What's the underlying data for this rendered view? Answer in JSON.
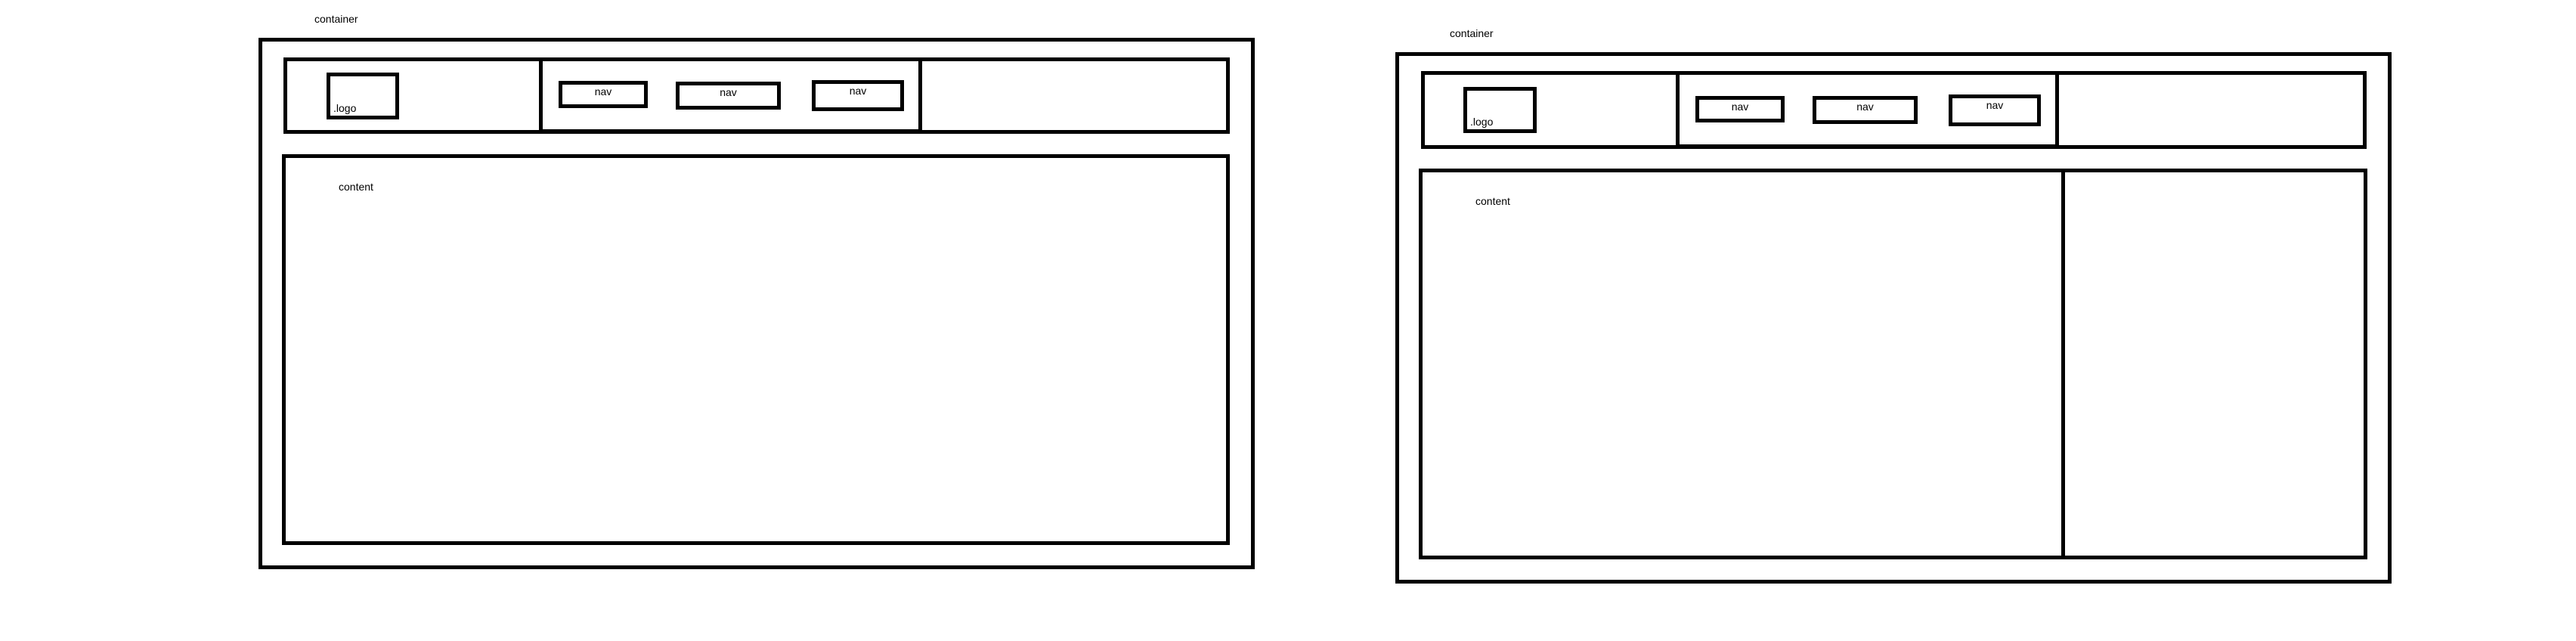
{
  "wireframes": [
    {
      "container_label": "container",
      "logo_label": ".logo",
      "nav_items": [
        "nav",
        "nav",
        "nav"
      ],
      "content_label": "content",
      "has_sidebar": false
    },
    {
      "container_label": "container",
      "logo_label": ".logo",
      "nav_items": [
        "nav",
        "nav",
        "nav"
      ],
      "content_label": "content",
      "has_sidebar": true
    }
  ]
}
